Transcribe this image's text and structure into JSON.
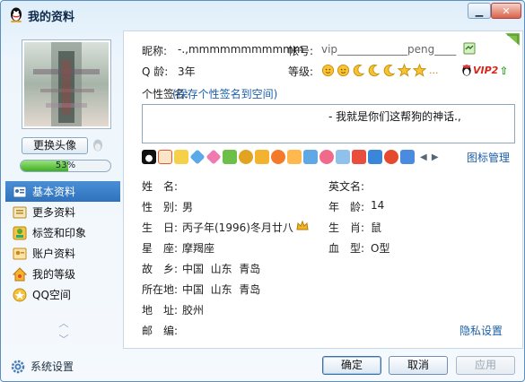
{
  "window": {
    "title": "我的资料",
    "minimize_icon": "minimize-icon",
    "close_icon": "close-icon"
  },
  "sidebar": {
    "change_avatar_label": "更换头像",
    "progress_percent": 53,
    "progress_label": "53%",
    "items": [
      {
        "label": "基本资料",
        "icon": "profile-card-icon",
        "active": true
      },
      {
        "label": "更多资料",
        "icon": "more-info-icon",
        "active": false
      },
      {
        "label": "标签和印象",
        "icon": "tag-icon",
        "active": false
      },
      {
        "label": "账户资料",
        "icon": "account-icon",
        "active": false
      },
      {
        "label": "我的等级",
        "icon": "level-house-icon",
        "active": false
      },
      {
        "label": "QQ空间",
        "icon": "qzone-icon",
        "active": false
      }
    ],
    "settings_label": "系统设置"
  },
  "profile": {
    "nickname_label": "昵称:",
    "nickname_value": "-.,mmmmmmmmmmm",
    "account_label": "帐号:",
    "account_value": "vip_____________peng____",
    "qage_label": "Q 龄:",
    "qage_value": "3年",
    "level_label": "等级:",
    "level_icons": [
      "sun",
      "sun",
      "moon",
      "moon",
      "moon",
      "star",
      "star"
    ],
    "level_more": "...",
    "vip_label": "VIP2",
    "signature_label": "个性签名:",
    "signature_link": "(保存个性签名到空间)",
    "signature_text": "- 我就是你们这帮狗的神话.,",
    "icon_manage_label": "图标管理",
    "toolbar_arrows": "◀ ▶"
  },
  "fields": {
    "name_label": "姓　名:",
    "name_value": "",
    "english_name_label": "英文名:",
    "english_name_value": "",
    "gender_label": "性　别:",
    "gender_value": "男",
    "age_label": "年　龄:",
    "age_value": "14",
    "birthday_label": "生　日:",
    "birthday_value": "丙子年(1996)冬月廿八",
    "zodiac_label": "生　肖:",
    "zodiac_value": "鼠",
    "constellation_label": "星　座:",
    "constellation_value": "摩羯座",
    "blood_label": "血　型:",
    "blood_value": "O型",
    "hometown_label": "故　乡:",
    "hometown_value": "中国  山东  青岛",
    "location_label": "所在地:",
    "location_value": "中国  山东  青岛",
    "address_label": "地　址:",
    "address_value": "胶州",
    "postcode_label": "邮　编:",
    "postcode_value": "",
    "privacy_link": "隐私设置"
  },
  "buttons": {
    "ok": "确定",
    "cancel": "取消",
    "apply": "应用"
  },
  "colors": {
    "accent": "#2f72bd",
    "link": "#1c5fa8",
    "progress": "#3fae25",
    "vip": "#d8261c"
  }
}
